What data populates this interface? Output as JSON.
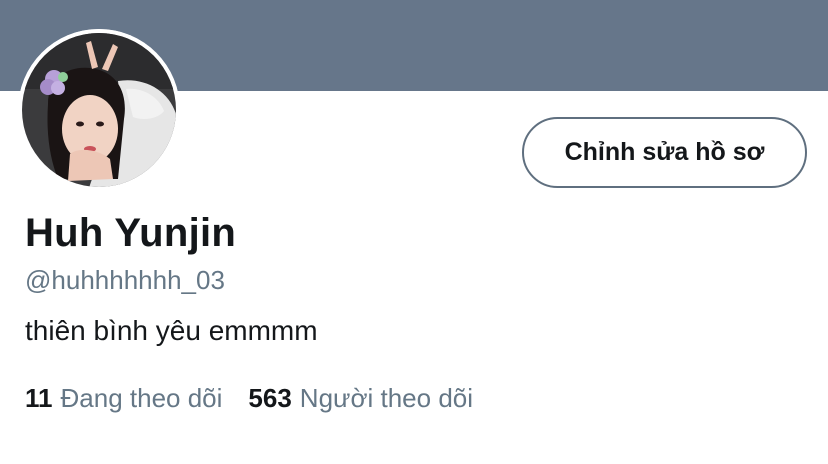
{
  "profile": {
    "name": "Huh Yunjin",
    "handle": "@huhhhhhhh_03",
    "bio": "thiên bình yêu emmmm"
  },
  "actions": {
    "edit_profile_label": "Chỉnh sửa hồ sơ"
  },
  "stats": {
    "following_count": "11",
    "following_label": "Đang theo dõi",
    "followers_count": "563",
    "followers_label": "Người theo dõi"
  },
  "colors": {
    "banner": "#66768a",
    "text_primary": "#14171a",
    "text_secondary": "#657786",
    "button_border": "#5f6f7f"
  },
  "icons": {
    "avatar": "profile-photo"
  }
}
